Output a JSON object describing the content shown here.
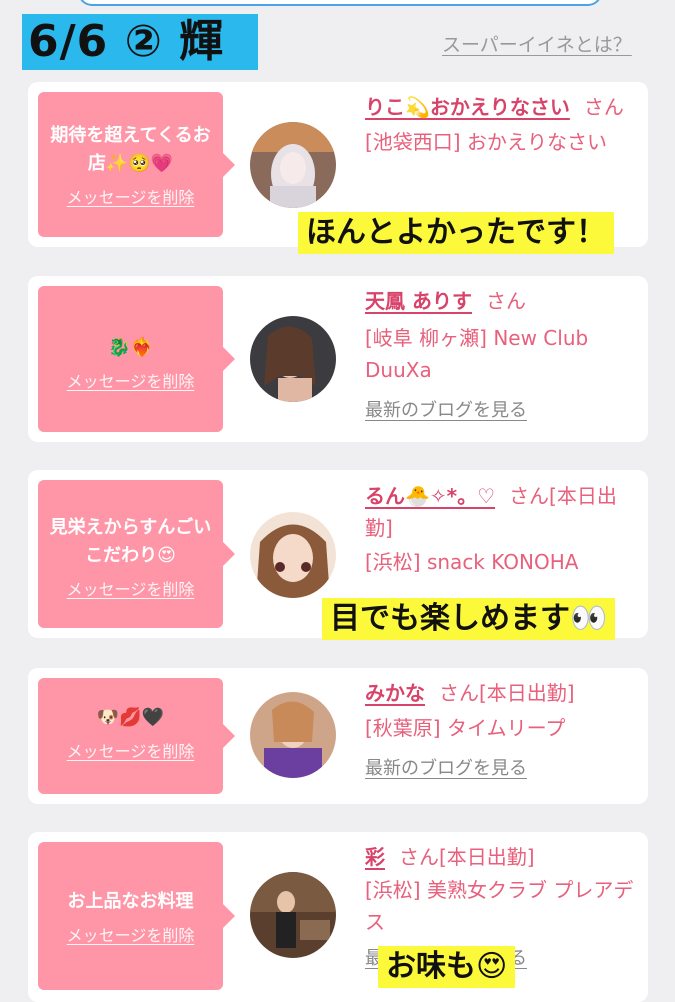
{
  "header": {
    "date_label": "6/6 ② 輝",
    "super_link": "スーパーイイネとは？"
  },
  "cards": [
    {
      "message": "期待を超えてくるお店✨🥺💗",
      "delete_label": "メッセージを削除",
      "name": "りこ💫おかえりなさい",
      "san": "さん",
      "shop": "[池袋西口] おかえりなさい",
      "blog": "",
      "note": "ほんとよかったです！"
    },
    {
      "message": "🐉❤️‍🔥",
      "delete_label": "メッセージを削除",
      "name": "天鳳 ありす",
      "san": "さん",
      "shop": "[岐阜 柳ヶ瀬] New Club DuuXa",
      "blog": "最新のブログを見る",
      "note": ""
    },
    {
      "message": "見栄えからすんごいこだわり😍",
      "delete_label": "メッセージを削除",
      "name": "るん🐣✧*。♡",
      "san": "さん[本日出勤]",
      "shop": "[浜松] snack KONOHA",
      "blog": "",
      "note": "目でも楽しめます👀"
    },
    {
      "message": "🐶💋🖤",
      "delete_label": "メッセージを削除",
      "name": "みかな",
      "san": "さん[本日出勤]",
      "shop": "[秋葉原] タイムリープ",
      "blog": "最新のブログを見る",
      "note": ""
    },
    {
      "message": "お上品なお料理",
      "delete_label": "メッセージを削除",
      "name": "彩",
      "san": "さん[本日出勤]",
      "shop": "[浜松] 美熟女クラブ プレアデス",
      "blog": "最新のブログを見る",
      "note": "お味も😍"
    }
  ]
}
